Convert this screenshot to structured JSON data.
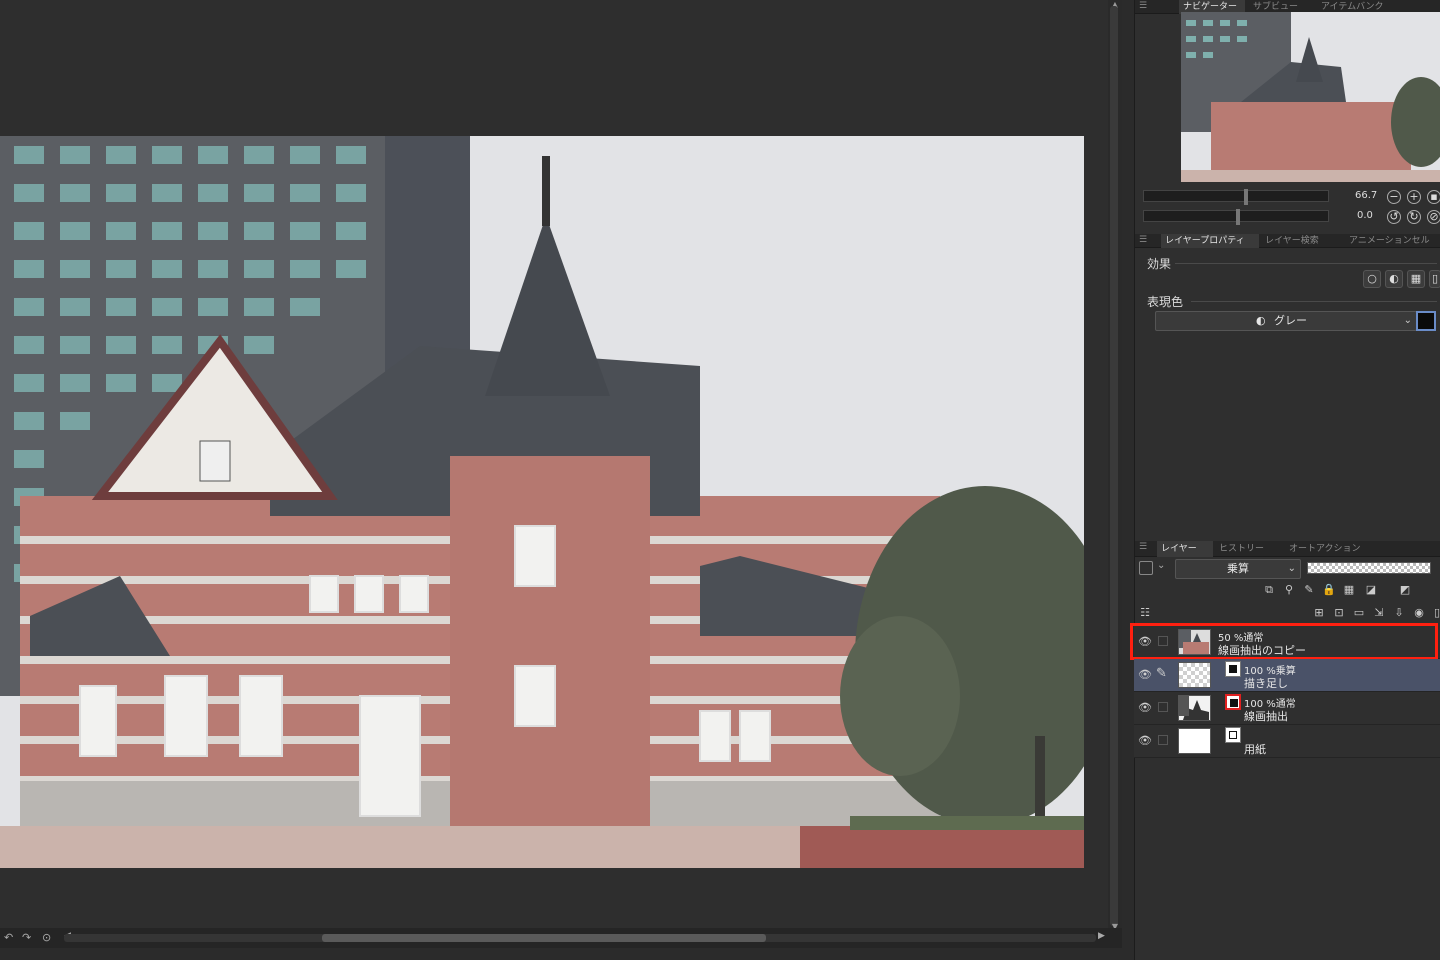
{
  "navigator": {
    "tabs": [
      "ナビゲーター",
      "サブビュー",
      "アイテムバンク"
    ],
    "zoom_value": "66.7",
    "rotation_value": "0.0"
  },
  "properties": {
    "tabs": [
      "レイヤープロパティ",
      "レイヤー検索",
      "アニメーションセル"
    ],
    "effect_label": "効果",
    "color_label": "表現色",
    "color_mode": "グレー",
    "color_swatch": "#0a0a0a"
  },
  "layers_panel": {
    "tabs": [
      "レイヤー",
      "ヒストリー",
      "オートアクション"
    ],
    "blend_mode": "乗算",
    "layers": [
      {
        "line1": "50 %通常",
        "line2": "線画抽出のコピー"
      },
      {
        "line1": "100 %乗算",
        "line2": "描き足し"
      },
      {
        "line1": "100 %通常",
        "line2": "線画抽出"
      },
      {
        "line1": "",
        "line2": "用紙"
      }
    ]
  },
  "colors": {
    "highlight": "#ff2010",
    "selected_layer": "#4a5268"
  },
  "icons": [
    "eye-icon",
    "pen-icon",
    "zoom-out-icon",
    "zoom-in-icon",
    "fit-icon",
    "rotate-left-icon",
    "rotate-right-icon",
    "reset-icon",
    "menu-icon"
  ]
}
